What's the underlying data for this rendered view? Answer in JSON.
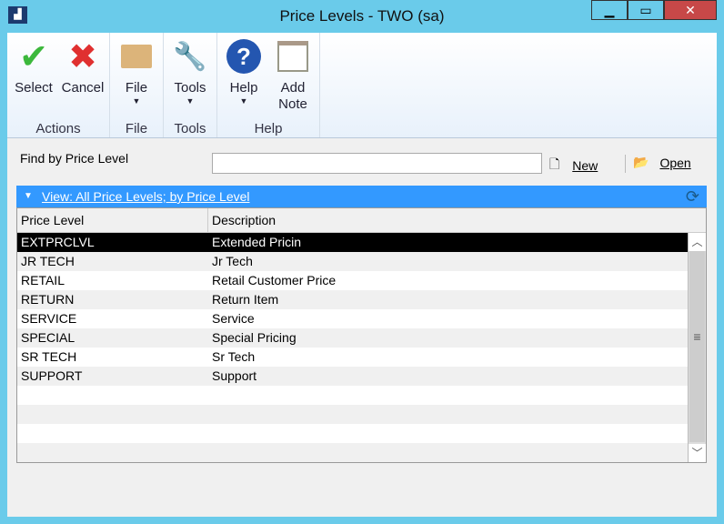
{
  "window": {
    "title": "Price Levels  -  TWO (sa)"
  },
  "ribbon": {
    "groups": [
      {
        "label": "Actions",
        "buttons": [
          {
            "label": "Select"
          },
          {
            "label": "Cancel"
          }
        ]
      },
      {
        "label": "File",
        "buttons": [
          {
            "label": "File"
          }
        ]
      },
      {
        "label": "Tools",
        "buttons": [
          {
            "label": "Tools"
          }
        ]
      },
      {
        "label": "Help",
        "buttons": [
          {
            "label": "Help"
          },
          {
            "label": "Add Note"
          }
        ]
      }
    ]
  },
  "find": {
    "label": "Find by Price Level",
    "value": "",
    "new_label": "New",
    "open_label": "Open"
  },
  "view": {
    "label": "View: All Price Levels; by Price Level"
  },
  "table": {
    "columns": [
      "Price Level",
      "Description"
    ],
    "rows": [
      [
        "EXTPRCLVL",
        "Extended Pricin"
      ],
      [
        "JR TECH",
        "Jr Tech"
      ],
      [
        "RETAIL",
        "Retail Customer Price"
      ],
      [
        "RETURN",
        "Return Item"
      ],
      [
        "SERVICE",
        "Service"
      ],
      [
        "SPECIAL",
        "Special Pricing"
      ],
      [
        "SR TECH",
        "Sr Tech"
      ],
      [
        "SUPPORT",
        "Support"
      ],
      [
        "",
        ""
      ],
      [
        "",
        ""
      ],
      [
        "",
        ""
      ],
      [
        "",
        ""
      ]
    ]
  }
}
